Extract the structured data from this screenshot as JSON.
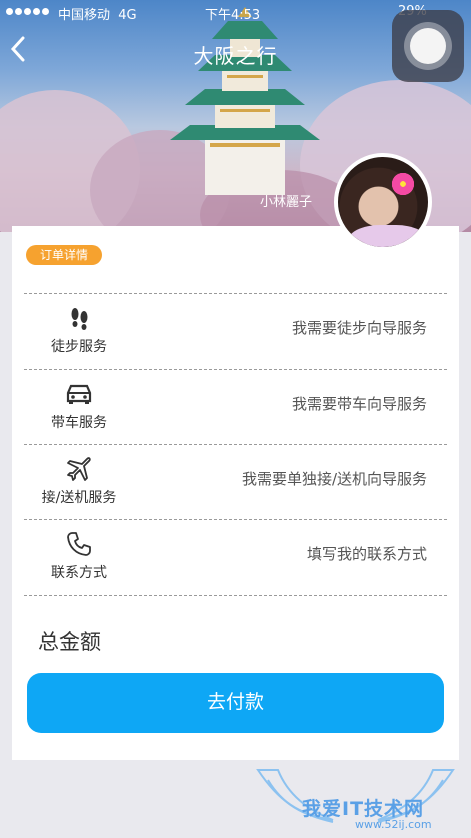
{
  "status_bar": {
    "carrier": "中国移动",
    "network": "4G",
    "time": "下午4:53",
    "battery": "29%"
  },
  "nav": {
    "back_icon": "chevron-left-icon",
    "title": "大阪之行"
  },
  "profile": {
    "username": "小林麗子"
  },
  "order": {
    "badge": "订单详情",
    "services": [
      {
        "icon": "footprints-icon",
        "label": "徒步服务",
        "value": "我需要徒步向导服务"
      },
      {
        "icon": "car-icon",
        "label": "带车服务",
        "value": "我需要带车向导服务"
      },
      {
        "icon": "airplane-icon",
        "label": "接/送机服务",
        "value": "我需要单独接/送机向导服务"
      },
      {
        "icon": "phone-icon",
        "label": "联系方式",
        "value": "填写我的联系方式"
      }
    ],
    "total_label": "总金额",
    "pay_button": "去付款"
  },
  "watermark": {
    "text": "我爱IT技术网",
    "url": "www.52ij.com"
  },
  "colors": {
    "badge": "#f6a22f",
    "pay_button": "#0ea7f5"
  }
}
